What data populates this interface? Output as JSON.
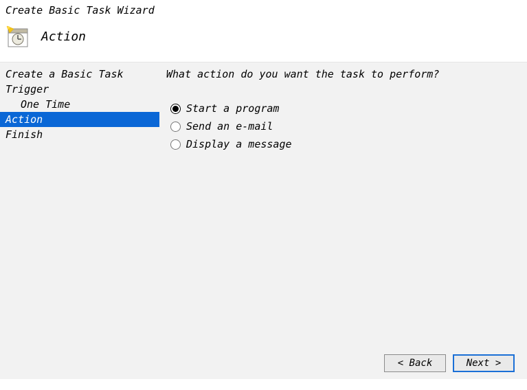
{
  "window_title": "Create Basic Task Wizard",
  "header": {
    "title": "Action"
  },
  "sidebar": {
    "items": [
      {
        "label": "Create a Basic Task",
        "indent": false,
        "selected": false
      },
      {
        "label": "Trigger",
        "indent": false,
        "selected": false
      },
      {
        "label": "One Time",
        "indent": true,
        "selected": false
      },
      {
        "label": "Action",
        "indent": false,
        "selected": true
      },
      {
        "label": "Finish",
        "indent": false,
        "selected": false
      }
    ]
  },
  "content": {
    "question": "What action do you want the task to perform?",
    "options": [
      {
        "label": "Start a program",
        "checked": true
      },
      {
        "label": "Send an e-mail",
        "checked": false
      },
      {
        "label": "Display a message",
        "checked": false
      }
    ]
  },
  "buttons": {
    "back": "< Back",
    "next": "Next >"
  }
}
